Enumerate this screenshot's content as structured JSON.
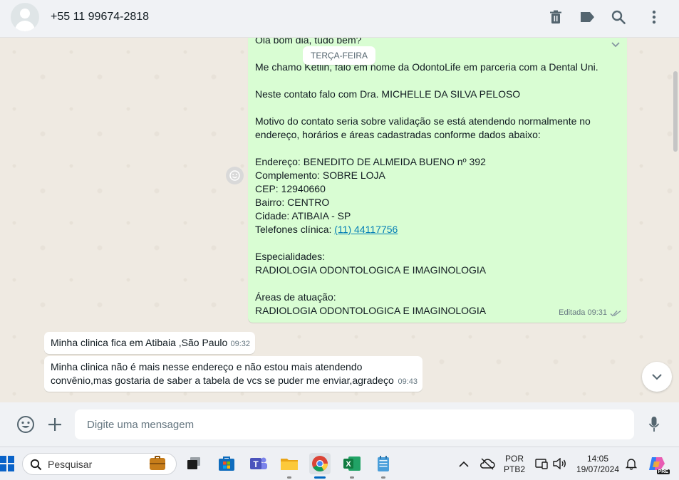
{
  "header": {
    "contact": "+55 11 99674-2818",
    "icons": [
      "trash-icon",
      "label-icon",
      "search-icon",
      "menu-icon"
    ]
  },
  "chat": {
    "date_chip": "TERÇA-FEIRA",
    "outgoing": {
      "lines": [
        "Olá bom dia, tudo bem?",
        "",
        "Me chamo Ketlin, falo em nome da OdontoLife em parceria com a Dental Uni.",
        "",
        "Neste contato falo com Dra. MICHELLE DA SILVA PELOSO",
        "",
        "Motivo do contato seria sobre validação se está atendendo normalmente no",
        "endereço, horários e áreas cadastradas conforme dados abaixo:",
        "",
        "Endereço: BENEDITO DE ALMEIDA BUENO nº 392",
        "Complemento: SOBRE LOJA",
        "CEP: 12940660",
        "Bairro: CENTRO",
        "Cidade: ATIBAIA - SP"
      ],
      "phone_label": "Telefones clínica: ",
      "phone_link": "(11) 44117756",
      "lines_after": [
        "",
        "Especialidades:",
        "RADIOLOGIA ODONTOLOGICA E IMAGINOLOGIA",
        "",
        "Áreas de atuação:",
        "RADIOLOGIA ODONTOLOGICA E IMAGINOLOGIA"
      ],
      "meta": "Editada 09:31"
    },
    "incoming": [
      {
        "text": "Minha clinica fica em Atibaia ,São Paulo",
        "time": "09:32"
      },
      {
        "line1": "Minha clinica não é mais nesse endereço e não estou mais atendendo",
        "line2": "convênio,mas gostaria de saber a tabela de vcs se puder me enviar,agradeço",
        "time": "09:43"
      }
    ]
  },
  "composer": {
    "placeholder": "Digite uma mensagem"
  },
  "taskbar": {
    "search_placeholder": "Pesquisar",
    "lang_top": "POR",
    "lang_bottom": "PTB2",
    "time": "14:05",
    "date": "19/07/2024",
    "copilot_badge": "PRE"
  },
  "colors": {
    "outgoing_bubble": "#d9fdd3",
    "incoming_bubble": "#ffffff",
    "chat_bg": "#efeae2",
    "link": "#027eb5",
    "read_ticks": "#8696a0"
  }
}
